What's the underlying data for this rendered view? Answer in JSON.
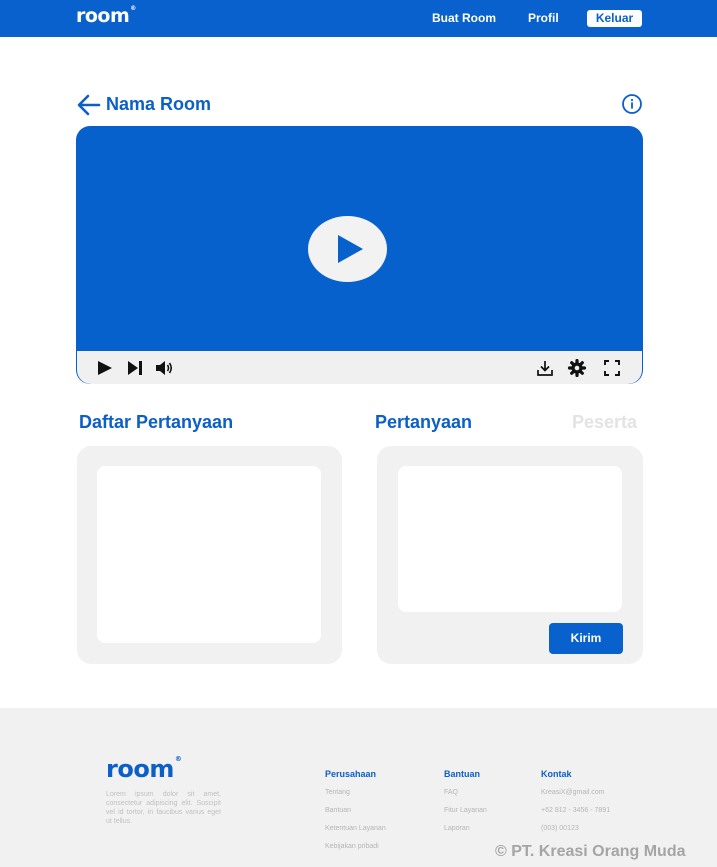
{
  "navbar": {
    "logo": "room",
    "logo_mark": "®",
    "links": [
      {
        "label": "Buat Room"
      },
      {
        "label": "Profil"
      }
    ],
    "logout_label": "Keluar",
    "background": "#0861cd"
  },
  "room": {
    "title": "Nama Room",
    "back_icon": "arrow-left-icon",
    "info_icon": "info-icon"
  },
  "video": {
    "background": "#0661cd",
    "big_play_icon": "play-icon",
    "controls_left": [
      "play-icon",
      "skip-next-icon",
      "volume-icon"
    ],
    "controls_right": [
      "download-icon",
      "gear-icon",
      "fullscreen-icon"
    ]
  },
  "sections": {
    "list_title": "Daftar Pertanyaan",
    "tabs": [
      {
        "label": "Pertanyaan",
        "active": true
      },
      {
        "label": "Peserta",
        "active": false
      }
    ]
  },
  "question_form": {
    "input_value": "",
    "send_label": "Kirim"
  },
  "footer": {
    "logo": "room",
    "logo_mark": "®",
    "description": "Lorem ipsum dolor sit amet, consectetur adipiscing elit. Suscipit vel id tortor, in faucibus varius eget ut tellus.",
    "columns": [
      {
        "heading": "Perusahaan",
        "links": [
          "Tentang",
          "Bantuan",
          "Ketentuan Layanan",
          "Kebijakan pribadi"
        ]
      },
      {
        "heading": "Bantuan",
        "links": [
          "FAQ",
          "Fitur Layanan",
          "Laporan"
        ]
      },
      {
        "heading": "Kontak",
        "links": [
          "KreasiX@gmail.com",
          "+62 812 - 3456 - 7891",
          "(003) 00123"
        ]
      }
    ],
    "copyright": "PT. Kreasi Orang Muda"
  }
}
